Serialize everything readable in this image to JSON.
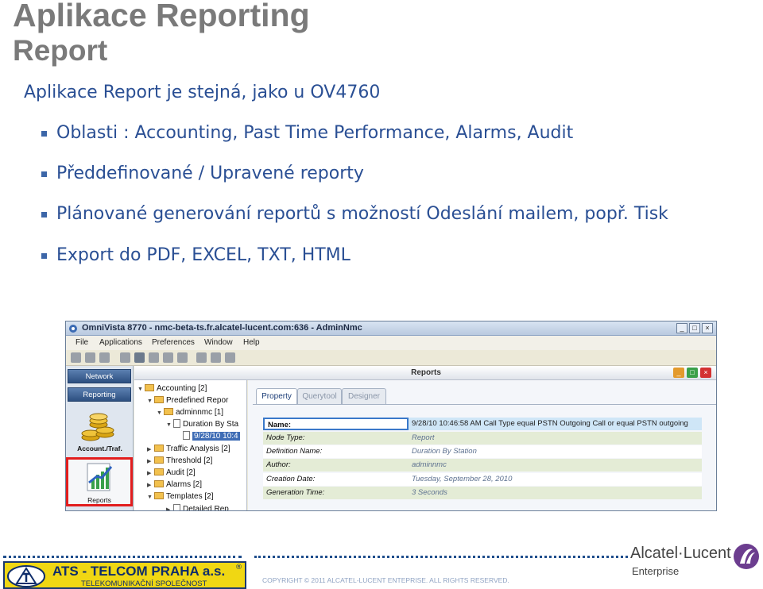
{
  "slide": {
    "title": "Aplikace Reporting",
    "subtitle": "Report",
    "intro": "Aplikace Report je stejná, jako u OV4760",
    "bullets": [
      "Oblasti : Accounting, Past Time Performance, Alarms, Audit",
      "Předdefinované / Upravené reporty",
      "Plánované generování reportů s možností Odeslání mailem, popř. Tisk",
      "Export do PDF, EXCEL, TXT, HTML"
    ]
  },
  "app": {
    "window_title": "OmniVista 8770 - nmc-beta-ts.fr.alcatel-lucent.com:636 - AdminNmc",
    "menu": [
      "File",
      "Applications",
      "Preferences",
      "Window",
      "Help"
    ],
    "nav": {
      "network": "Network",
      "reporting": "Reporting",
      "accounting_label": "Account./Traf.",
      "reports_label": "Reports"
    },
    "panel_title": "Reports",
    "tree": [
      {
        "label": "Accounting [2]",
        "type": "folder",
        "expanded": true
      },
      {
        "label": "Predefined Repor",
        "type": "folder",
        "expanded": true
      },
      {
        "label": "adminnmc [1]",
        "type": "folder",
        "expanded": true
      },
      {
        "label": "Duration By Sta",
        "type": "doc",
        "expanded": true
      },
      {
        "label": "9/28/10 10:4",
        "type": "doc",
        "selected": true
      },
      {
        "label": "Traffic Analysis [2]",
        "type": "folder"
      },
      {
        "label": "Threshold [2]",
        "type": "folder"
      },
      {
        "label": "Audit [2]",
        "type": "folder"
      },
      {
        "label": "Alarms [2]",
        "type": "folder"
      },
      {
        "label": "Templates [2]",
        "type": "folder"
      },
      {
        "label": "Detailed Rep",
        "type": "doc"
      }
    ],
    "tabs": [
      "Property",
      "Querytool",
      "Designer"
    ],
    "properties": [
      {
        "name": "Name:",
        "value": "9/28/10 10:46:58 AM Call Type  equal PSTN Outgoing Call or equal PSTN outgoing"
      },
      {
        "name": "Node Type:",
        "value": "Report"
      },
      {
        "name": "Definition Name:",
        "value": "Duration By Station"
      },
      {
        "name": "Author:",
        "value": "adminnmc"
      },
      {
        "name": "Creation Date:",
        "value": "Tuesday, September 28, 2010"
      },
      {
        "name": "Generation Time:",
        "value": "3 Seconds"
      }
    ]
  },
  "footer": {
    "ats_name": "ATS - TELCOM PRAHA a.s.",
    "ats_reg": "®",
    "ats_tagline": "TELEKOMUNIKAČNÍ SPOLEČNOST",
    "copyright": "COPYRIGHT © 2011 ALCATEL-LUCENT ENTEPRISE.  ALL RIGHTS RESERVED.",
    "al_name": "Alcatel·Lucent",
    "al_sub": "Enterprise"
  },
  "colors": {
    "title_gray": "#7a7a7a",
    "text_blue": "#2a4f94",
    "highlight_red": "#e21d1d",
    "ats_yellow": "#f0d713",
    "al_purple": "#6c3d8f"
  }
}
